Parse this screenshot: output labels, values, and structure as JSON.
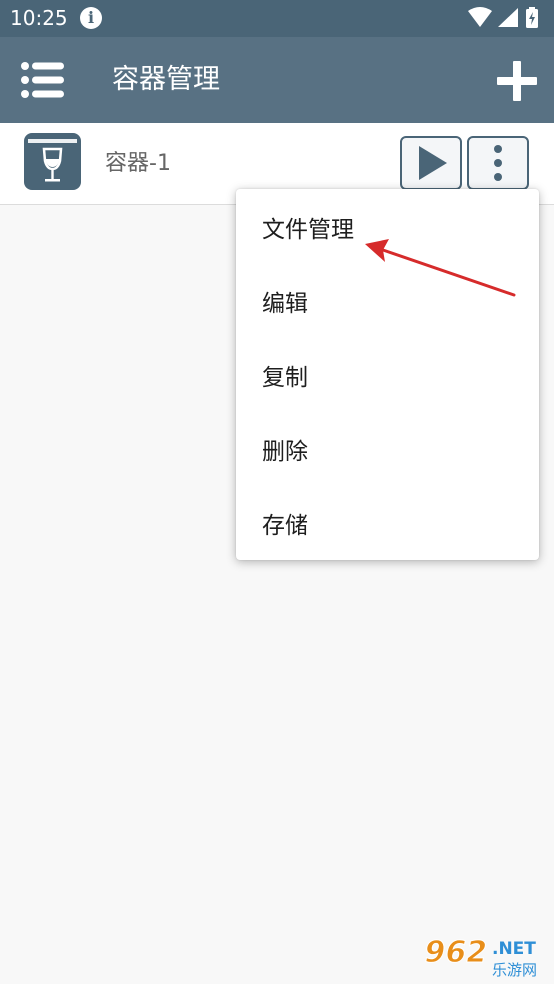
{
  "status_bar": {
    "time": "10:25",
    "info_icon_glyph": "i",
    "icons": [
      "info-icon",
      "wifi-icon",
      "signal-icon",
      "battery-icon"
    ]
  },
  "app_bar": {
    "title": "容器管理",
    "menu_icon": "list-icon",
    "add_icon": "plus-icon"
  },
  "container": {
    "name": "容器-1",
    "icon": "wine-glass-icon",
    "play_icon": "play-icon",
    "more_icon": "more-vert-icon"
  },
  "popup_menu": {
    "items": [
      "文件管理",
      "编辑",
      "复制",
      "删除",
      "存储"
    ]
  },
  "annotation": {
    "arrow_color": "#d62b2b"
  },
  "watermark": {
    "number": "962",
    "suffix": ".NET",
    "tagline": "乐游网"
  },
  "colors": {
    "app_bar": "#587183",
    "status_bar": "#4a6577",
    "accent": "#4a6577",
    "background": "#f8f8f8"
  }
}
